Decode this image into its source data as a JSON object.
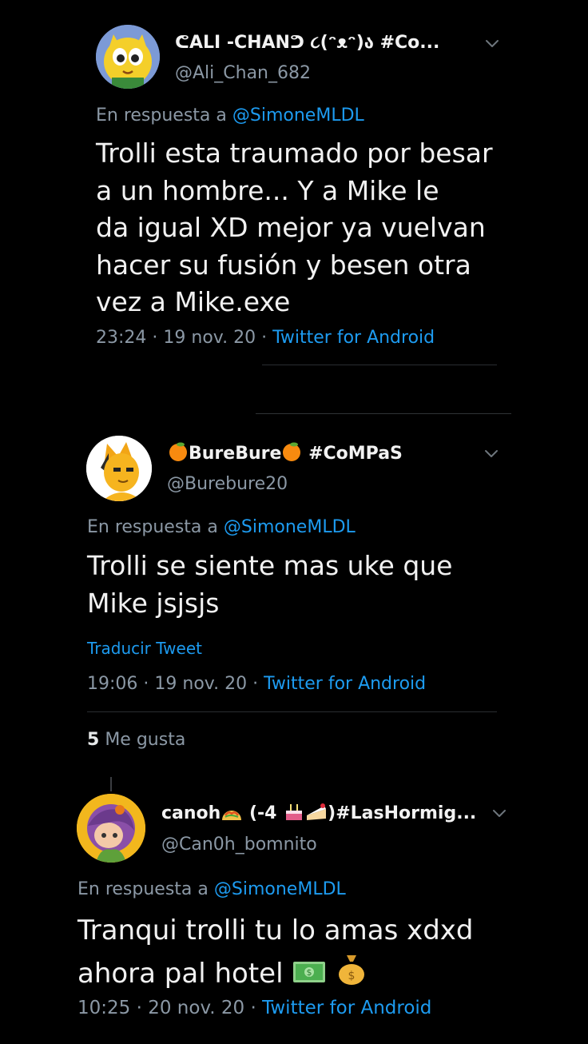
{
  "tweets": [
    {
      "display_name": "ᕦALI -CHANᕤ ૮(ᵔᴥᵔ)ა #Co...",
      "handle": "@Ali_Chan_682",
      "reply_prefix": "En respuesta a",
      "reply_to": "@SimoneMLDL",
      "lines": [
        "Trolli esta traumado por besar",
        "a un hombre... Y a Mike le",
        "da igual XD mejor ya vuelvan",
        "hacer su fusión y besen otra",
        "vez a Mike.exe"
      ],
      "time": "23:24",
      "date": "19 nov. 20",
      "source": "Twitter for Android"
    },
    {
      "display_name_before": "BureBure",
      "display_name_after": "#CoMPaS",
      "handle": "@Burebure20",
      "reply_prefix": "En respuesta a",
      "reply_to": "@SimoneMLDL",
      "lines": [
        "Trolli se siente mas uke que",
        "Mike jsjsjs"
      ],
      "translate": "Traducir Tweet",
      "time": "19:06",
      "date": "19 nov. 20",
      "source": "Twitter for Android",
      "likes_count": "5",
      "likes_label": "Me gusta"
    },
    {
      "display_name_a": "canoh",
      "display_name_b": "(-4",
      "display_name_c": ")#LasHormig...",
      "handle": "@Can0h_bomnito",
      "reply_prefix": "En respuesta a",
      "reply_to": "@SimoneMLDL",
      "lines": [
        "Tranqui trolli tu lo amas xdxd",
        "ahora pal hotel"
      ],
      "time": "10:25",
      "date": "20 nov. 20",
      "source": "Twitter for Android"
    }
  ],
  "separator": "·",
  "colors": {
    "background": "#000000",
    "link": "#1d9bf0",
    "muted": "#8b98a5",
    "text": "#f1f1f1"
  }
}
